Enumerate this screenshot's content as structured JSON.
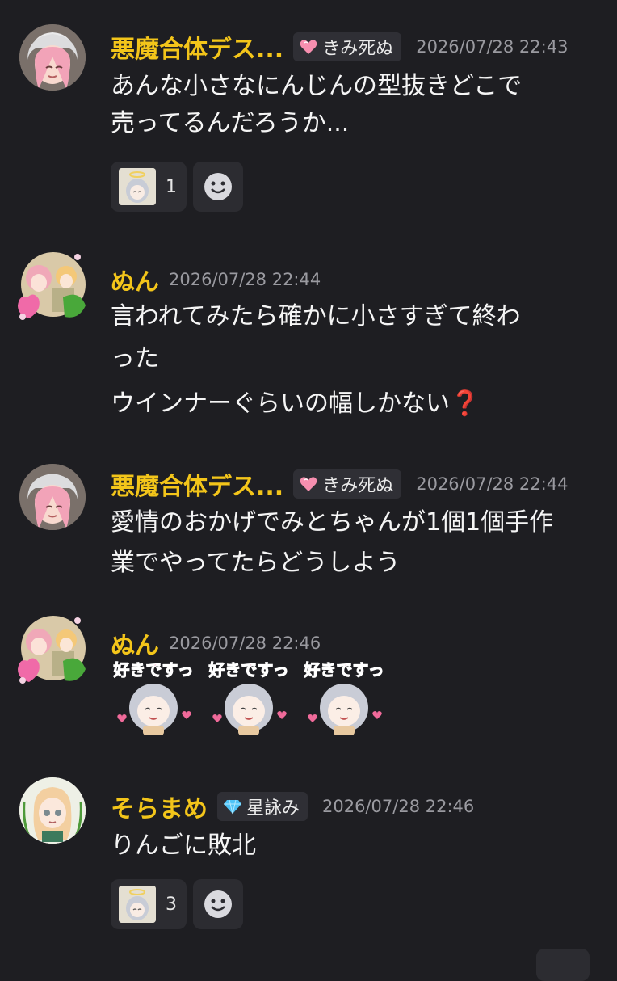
{
  "messages": [
    {
      "name": "悪魔合体デス...",
      "role": "きみ死ぬ",
      "time": "2026/07/28 22:43",
      "lines": [
        "あんな小さなにんじんの型抜きどこで",
        "売ってるんだろうか..."
      ],
      "reaction_count": "1"
    },
    {
      "name": "ぬん",
      "time": "2026/07/28 22:44",
      "lines": [
        "言われてみたら確かに小さすぎて終わ",
        "った",
        "ウインナーぐらいの幅しかない❓"
      ]
    },
    {
      "name": "悪魔合体デス...",
      "role": "きみ死ぬ",
      "time": "2026/07/28 22:44",
      "lines": [
        "愛情のおかげでみとちゃんが1個1個手作",
        "業でやってたらどうしよう"
      ]
    },
    {
      "name": "ぬん",
      "time": "2026/07/28 22:46",
      "sticker_text": "好きですっ"
    },
    {
      "name": "そらまめ",
      "role": "星詠み",
      "time": "2026/07/28 22:46",
      "lines": [
        "りんごに敗北"
      ],
      "reaction_count": "3"
    }
  ],
  "colors": {
    "background": "#1e1e22",
    "username": "#f3c51a",
    "timestamp": "#9a9aa0",
    "text": "#f5f5f5",
    "role_chip": "#2f2f35",
    "reaction_bg": "#2c2c31"
  },
  "icons": {
    "role_heart": "heart-icon",
    "role_gem": "gem-icon",
    "add_reaction": "smiley-icon"
  }
}
